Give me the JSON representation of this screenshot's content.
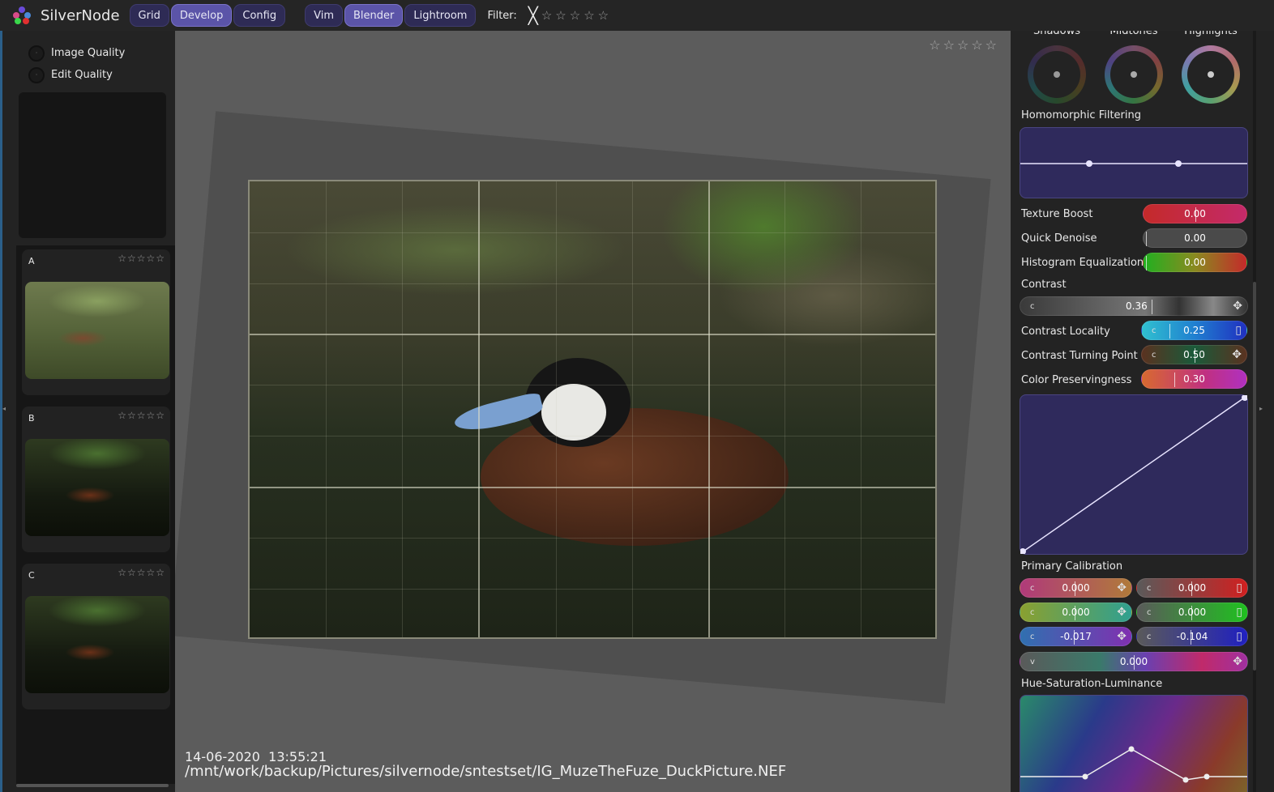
{
  "app": {
    "name": "SilverNode"
  },
  "toolbar": {
    "modes": [
      {
        "label": "Grid",
        "active": false
      },
      {
        "label": "Develop",
        "active": true
      },
      {
        "label": "Config",
        "active": false
      }
    ],
    "keymaps": [
      {
        "label": "Vim",
        "active": false
      },
      {
        "label": "Blender",
        "active": true
      },
      {
        "label": "Lightroom",
        "active": false
      }
    ],
    "filter_label": "Filter:",
    "filter_rating": 0
  },
  "left": {
    "quality": [
      {
        "label": "Image Quality"
      },
      {
        "label": "Edit Quality"
      }
    ],
    "thumbnails": [
      {
        "label": "A",
        "rating": 0
      },
      {
        "label": "B",
        "rating": 0
      },
      {
        "label": "C",
        "rating": 0
      }
    ]
  },
  "viewer": {
    "rating": 0,
    "date": "14-06-2020",
    "time": "13:55:21",
    "path": "/mnt/work/backup/Pictures/silvernode/sntestset/IG_MuzeTheFuze_DuckPicture.NEF"
  },
  "panel": {
    "wheels": [
      {
        "label": "Shadows"
      },
      {
        "label": "Midtones"
      },
      {
        "label": "Highlights"
      }
    ],
    "homomorphic_label": "Homomorphic Filtering",
    "texture_boost": {
      "label": "Texture Boost",
      "value": "0.00"
    },
    "quick_denoise": {
      "label": "Quick Denoise",
      "value": "0.00"
    },
    "histogram_eq": {
      "label": "Histogram Equalization",
      "value": "0.00"
    },
    "contrast": {
      "label": "Contrast",
      "value": "0.36",
      "prefix": "c"
    },
    "contrast_locality": {
      "label": "Contrast Locality",
      "value": "0.25",
      "prefix": "c"
    },
    "contrast_turning": {
      "label": "Contrast Turning Point",
      "value": "0.50",
      "prefix": "c"
    },
    "color_preserve": {
      "label": "Color Preservingness",
      "value": "0.30"
    },
    "primary_calibration": {
      "label": "Primary Calibration",
      "rows": [
        {
          "left": "0.000",
          "right": "0.000"
        },
        {
          "left": "0.000",
          "right": "0.000"
        },
        {
          "left": "-0.017",
          "right": "-0.104"
        }
      ],
      "prefix": "c",
      "v_prefix": "v",
      "v_value": "0.000"
    },
    "hsl_label": "Hue-Saturation-Luminance"
  },
  "colors": {
    "accent": "#5b54a8",
    "button": "#2e2b55",
    "curve_bg": "#2f2a5c"
  }
}
